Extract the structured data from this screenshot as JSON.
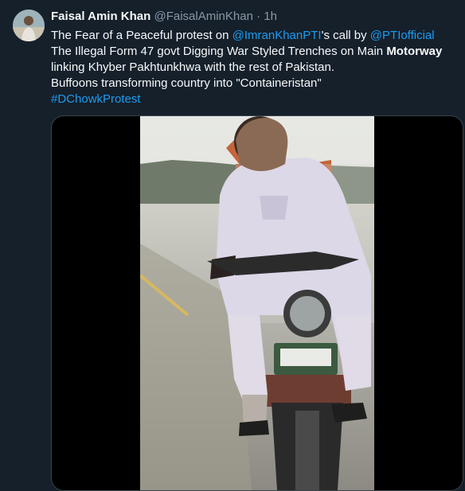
{
  "tweet": {
    "author_name": "Faisal Amin Khan",
    "author_handle": "@FaisalAminKhan",
    "separator": "·",
    "time": "1h",
    "line1": {
      "before": "The Fear of a Peaceful protest on ",
      "mention1": "@ImranKhanPTI",
      "middle": "'s call by ",
      "mention2": "@PTIofficial"
    },
    "line2": {
      "before": "The Illegal Form 47 govt Digging War Styled Trenches on Main ",
      "bold": "Motorway"
    },
    "line3": "linking Khyber Pakhtunkhwa with the rest of Pakistan.",
    "line4": "Buffoons transforming country into \"Containeristan\"",
    "hashtag": "#DChowkProtest"
  },
  "colors": {
    "background": "#15202b",
    "link": "#1d9bf0",
    "secondary_text": "#8b98a5",
    "border": "#38444d"
  },
  "media": {
    "type": "video",
    "description_icon": "video-thumbnail"
  }
}
